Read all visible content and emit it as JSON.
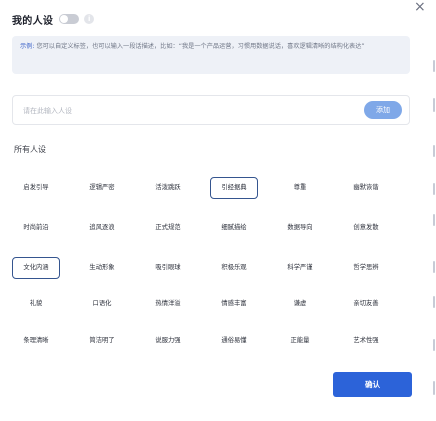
{
  "header": {
    "title": "我的人设",
    "info_icon": "i"
  },
  "hint": {
    "prefix": "示例:",
    "text": "您可以自定义标签，也可以输入一段话描述，比如：“我是一个产品运营，习惯用数据说话，喜欢逻辑清晰的结构化表达”"
  },
  "input": {
    "placeholder": "请在此输入人设",
    "value": "",
    "add_label": "添加"
  },
  "section": {
    "all_label": "所有人设"
  },
  "tags": [
    [
      "启发引导",
      "逻辑严密",
      "活泼跳跃",
      "引经据典",
      "尊重",
      "幽默诙谐"
    ],
    [
      "时尚前沿",
      "追风逐浪",
      "正式规范",
      "细腻描绘",
      "数据导向",
      "创意发散"
    ],
    [
      "文化内涵",
      "生动形象",
      "吸引眼球",
      "积极乐观",
      "科学严谨",
      "哲学思辨"
    ],
    [
      "礼貌",
      "口语化",
      "热情洋溢",
      "情感丰富",
      "谦虚",
      "亲切友善"
    ],
    [
      "条理清晰",
      "简洁明了",
      "说服力强",
      "通俗易懂",
      "正能量",
      "艺术性强"
    ]
  ],
  "selected_tags": [
    "引经据典",
    "文化内涵"
  ],
  "confirm_label": "确认",
  "colors": {
    "accent": "#2c63d9",
    "add_button": "#7fa8e8",
    "selected_border": "#35558f",
    "hint_bg": "#eef1f7"
  }
}
